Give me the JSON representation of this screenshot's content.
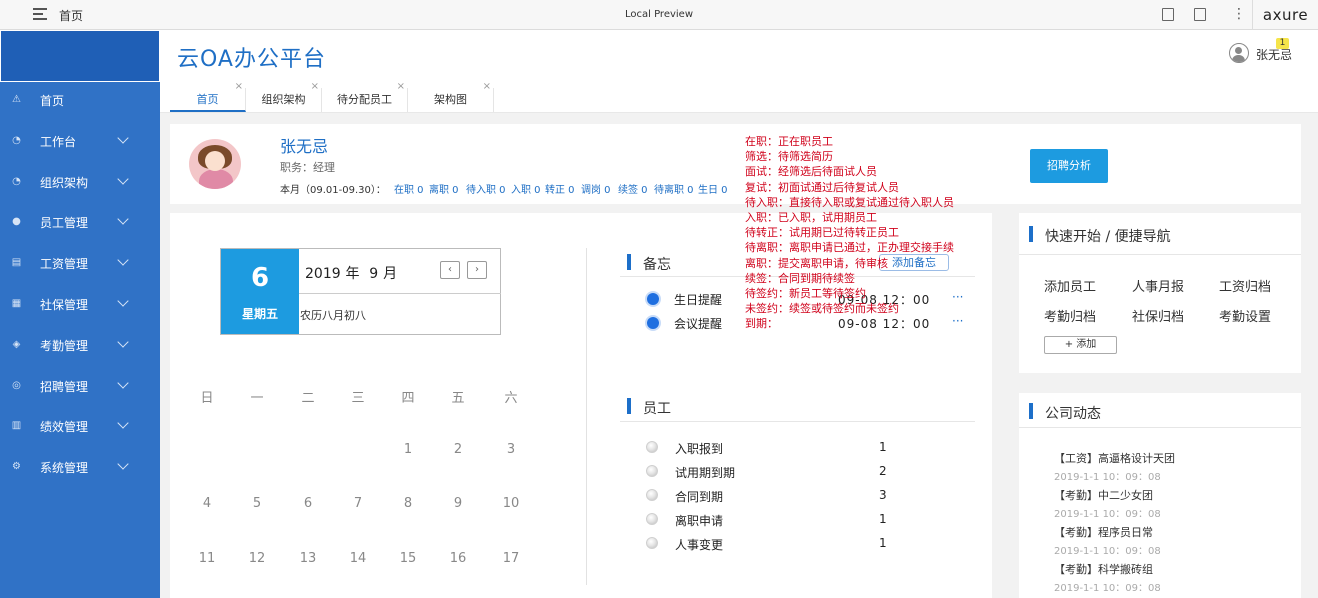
{
  "browser": {
    "breadcrumb": "首页",
    "preview_title": "Local Preview",
    "brand": "axure"
  },
  "sidebar": {
    "items": [
      {
        "label": "首页",
        "icon": "warning-icon",
        "glyph": "⚠",
        "has_chevron": false
      },
      {
        "label": "工作台",
        "icon": "gauge-icon",
        "glyph": "◔",
        "has_chevron": true
      },
      {
        "label": "组织架构",
        "icon": "gauge-icon",
        "glyph": "◔",
        "has_chevron": true
      },
      {
        "label": "员工管理",
        "icon": "user-icon",
        "glyph": "●",
        "has_chevron": true
      },
      {
        "label": "工资管理",
        "icon": "chart-icon",
        "glyph": "▤",
        "has_chevron": true
      },
      {
        "label": "社保管理",
        "icon": "calendar-icon",
        "glyph": "▦",
        "has_chevron": true
      },
      {
        "label": "考勤管理",
        "icon": "cube-icon",
        "glyph": "◈",
        "has_chevron": true
      },
      {
        "label": "招聘管理",
        "icon": "user-circle-icon",
        "glyph": "◎",
        "has_chevron": true
      },
      {
        "label": "绩效管理",
        "icon": "list-icon",
        "glyph": "▥",
        "has_chevron": true
      },
      {
        "label": "系统管理",
        "icon": "gear-icon",
        "glyph": "⚙",
        "has_chevron": true
      }
    ]
  },
  "header": {
    "title": "云OA办公平台",
    "user_name": "张无忌",
    "badge_count": "1"
  },
  "tabs": [
    {
      "label": "首页",
      "active": true
    },
    {
      "label": "组织架构",
      "active": false
    },
    {
      "label": "待分配员工",
      "active": false
    },
    {
      "label": "架构图",
      "active": false
    }
  ],
  "tab_close": "×",
  "profile": {
    "name": "张无忌",
    "role_label": "职务：",
    "role": "经理",
    "month_label": "本月（09.01-09.30）：",
    "stats": [
      "在职 0",
      "离职 0",
      "待入职 0",
      "入职 0",
      "转正 0",
      "调岗 0",
      "续签 0",
      "待离职 0",
      "生日 0"
    ],
    "button": "招聘分析"
  },
  "annotation": [
    "在职：正在职员工",
    "筛选：待筛选简历",
    "面试：经筛选后待面试人员",
    "复试：初面试通过后待复试人员",
    "待入职：直接待入职或复试通过待入职人员",
    "入职：已入职，试用期员工",
    "待转正：试用期已过待转正员工",
    "待离职：离职申请已通过，正办理交接手续",
    "离职：提交离职申请，待审核",
    "续签：合同到期待续签",
    "待签约：新员工等待签约",
    "未签约：续签或待签约而未签约",
    "到期："
  ],
  "calendar": {
    "day": "6",
    "weekday": "星期五",
    "year": "2019",
    "year_unit": "年",
    "month": "9",
    "month_unit": "月",
    "lunar": "农历八月初八",
    "prev": "‹",
    "next": "›",
    "week_headers": [
      "日",
      "一",
      "二",
      "三",
      "四",
      "五",
      "六"
    ],
    "rows": [
      [
        "",
        "",
        "",
        "",
        "1",
        "2",
        "3"
      ],
      [
        "4",
        "5",
        "6",
        "7",
        "8",
        "9",
        "10"
      ],
      [
        "11",
        "12",
        "13",
        "14",
        "15",
        "16",
        "17"
      ]
    ]
  },
  "memo": {
    "title": "备忘",
    "add_label": "添加备忘",
    "items": [
      {
        "label": "生日提醒",
        "time": "09-08 12：00",
        "more": "···"
      },
      {
        "label": "会议提醒",
        "time": "09-08 12：00",
        "more": "···"
      }
    ]
  },
  "employees": {
    "title": "员工",
    "items": [
      {
        "label": "入职报到",
        "count": "1"
      },
      {
        "label": "试用期到期",
        "count": "2"
      },
      {
        "label": "合同到期",
        "count": "3"
      },
      {
        "label": "离职申请",
        "count": "1"
      },
      {
        "label": "人事变更",
        "count": "1"
      }
    ]
  },
  "quick_nav": {
    "title": "快速开始 / 便捷导航",
    "items": [
      "添加员工",
      "人事月报",
      "工资归档",
      "考勤归档",
      "社保归档",
      "考勤设置"
    ],
    "add_label": "+ 添加"
  },
  "news": {
    "title": "公司动态",
    "items": [
      {
        "title": "【工资】高逼格设计天团",
        "date": "2019-1-1 10：09：08"
      },
      {
        "title": "【考勤】中二少女团",
        "date": "2019-1-1 10：09：08"
      },
      {
        "title": "【考勤】程序员日常",
        "date": "2019-1-1 10：09：08"
      },
      {
        "title": "【考勤】科学搬砖组",
        "date": "2019-1-1 10：09：08"
      }
    ]
  },
  "colors": {
    "sidebar": "#3072c6",
    "accent": "#1d9be0",
    "title_blue": "#1f6fc5",
    "annotation_red": "#d0021b"
  }
}
